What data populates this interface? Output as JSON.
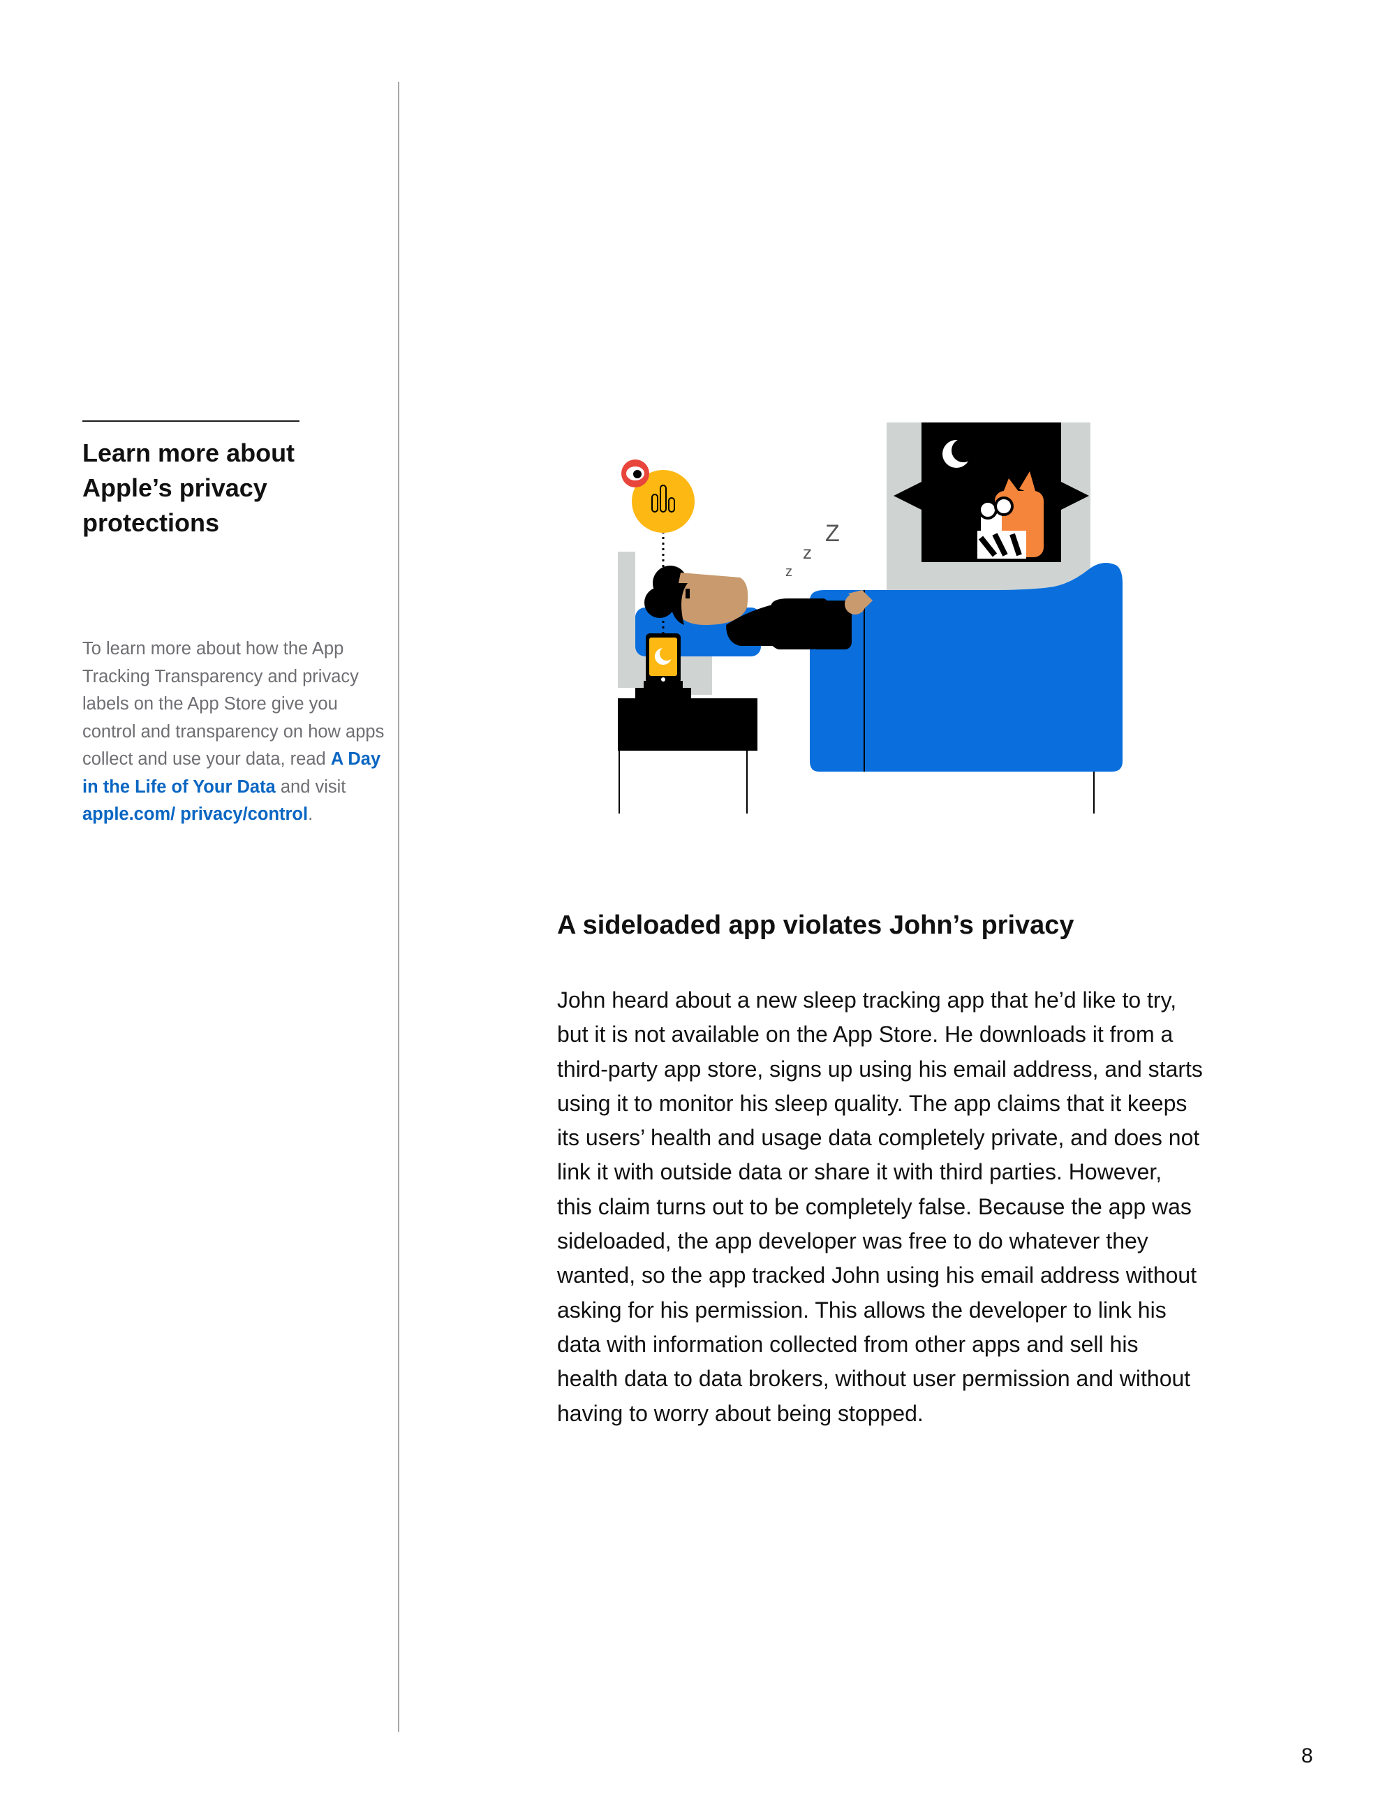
{
  "sidebar": {
    "heading_lines": [
      "Learn more about",
      "Apple’s privacy",
      "protections"
    ],
    "body_intro": "To learn more about how the App Tracking Transparency and privacy labels on the App Store give you control and transparency on how apps collect and use your data, read ",
    "link_day_in_life": "A Day in the Life of Your Data",
    "body_mid": " and visit ",
    "link_privacy": "apple.com/ privacy/control",
    "body_end": "."
  },
  "illustration": {
    "phone_icon": "crescent-moon-icon",
    "tracker_icon": "eye-icon",
    "sleep_letters": [
      "z",
      "z",
      "Z"
    ],
    "colors": {
      "blanket": "#0a6fdd",
      "phone": "#fdb813",
      "eye": "#e8453c",
      "tiger": "#f5853a",
      "wall": "#cfd4d3"
    }
  },
  "main": {
    "heading": "A sideloaded app violates John’s privacy",
    "body_lines": [
      "John heard about a new sleep tracking app that he’d like to try,",
      "but it is not available on the App Store. He downloads it from a",
      "third-party app store, signs up using his email address, and starts",
      "using it to monitor his sleep quality. The app claims that it keeps",
      "its users’ health and usage data completely private, and does not",
      "link it with outside data or share it with third parties. However,",
      "this claim turns out to be completely false. Because the app was",
      "sideloaded, the app developer was free to do whatever they",
      "wanted, so the app tracked John using his email address without",
      "asking for his permission. This allows the developer to link his",
      "data with information collected from other apps and sell his",
      "health data to data brokers, without user permission and without",
      "having to worry about being stopped."
    ]
  },
  "page_number": "8"
}
